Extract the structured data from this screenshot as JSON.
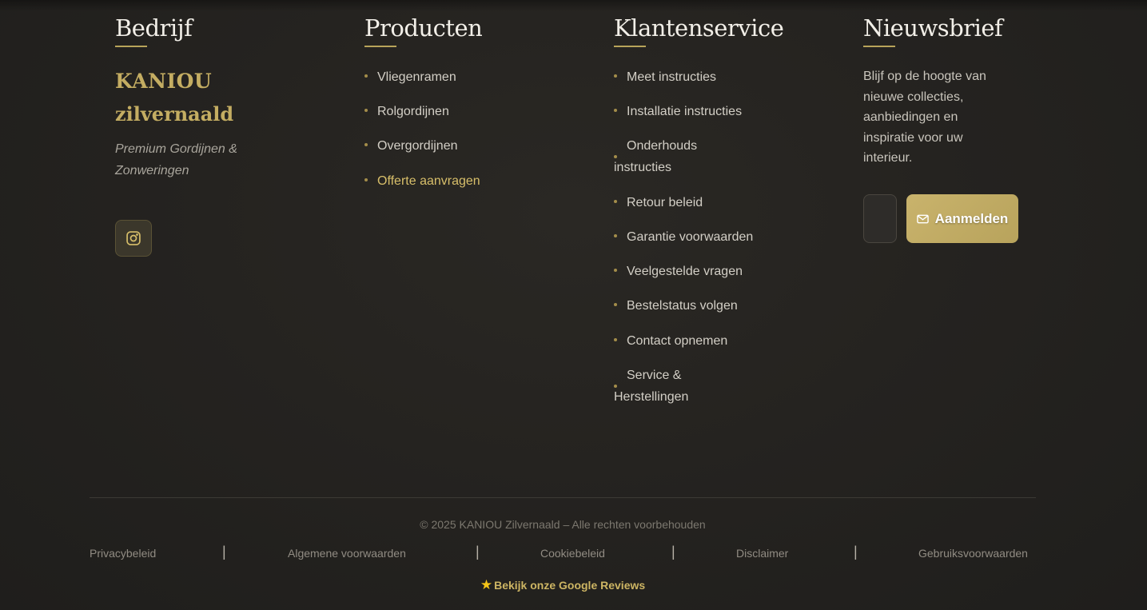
{
  "columns": {
    "company": {
      "title": "Bedrijf",
      "brand_line1": "KANIOU",
      "brand_line2": "zilvernaald",
      "tagline": "Premium Gordijnen & Zonweringen",
      "social_icon": "instagram-icon"
    },
    "products": {
      "title": "Producten",
      "links": [
        "Vliegenramen",
        "Rolgordijnen",
        "Overgordijnen",
        "Offerte aanvragen"
      ]
    },
    "service": {
      "title": "Klantenservice",
      "links": [
        "Meet instructies",
        "Installatie instructies",
        "Onderhouds instructies",
        "Retour beleid",
        "Garantie voorwaarden",
        "Veelgestelde vragen",
        "Bestelstatus volgen",
        "Contact opnemen",
        "Service & Herstellingen"
      ]
    },
    "newsletter": {
      "title": "Nieuwsbrief",
      "text": "Blijf op de hoogte van nieuwe collecties, aanbiedingen en inspiratie voor uw interieur.",
      "email_value": "",
      "button_label": "Aanmelden",
      "button_icon": "mail-icon"
    }
  },
  "footer": {
    "copyright": "© 2025 KANIOU Zilvernaald – Alle rechten voorbehouden",
    "legal_links": [
      "Privacybeleid",
      "Algemene voorwaarden",
      "Cookiebeleid",
      "Disclaimer",
      "Gebruiksvoorwaarden"
    ],
    "separator": "|",
    "reviews_label": "Bekijk onze Google Reviews",
    "reviews_icon": "star-icon"
  },
  "colors": {
    "accent_gold": "#c4ad62",
    "background": "#252320"
  }
}
